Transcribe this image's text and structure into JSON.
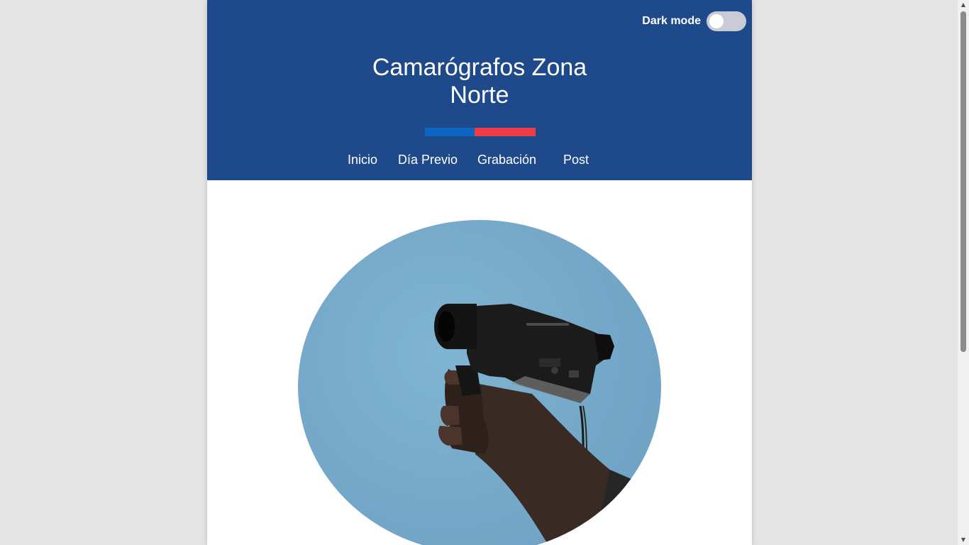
{
  "header": {
    "dark_mode_label": "Dark mode",
    "dark_mode_enabled": false,
    "title_line1": "Camarógrafos Zona",
    "title_line2": "Norte",
    "flag_colors": [
      "#0a66c2",
      "#ef3b45"
    ],
    "background_color": "#1e4a8c"
  },
  "nav": {
    "items": [
      {
        "label": "Inicio"
      },
      {
        "label": "Día Previo"
      },
      {
        "label": "Grabación"
      },
      {
        "label": "Post"
      }
    ]
  },
  "hero": {
    "icon": "hand-holding-video-camera-photo"
  },
  "scrollbar": {
    "up_icon": "▲",
    "down_icon": "▼"
  }
}
